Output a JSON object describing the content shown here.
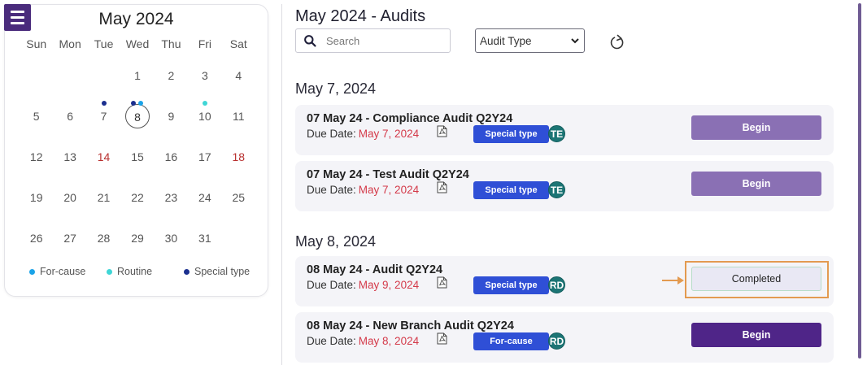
{
  "calendar": {
    "title": "May 2024",
    "weekdays": [
      "Sun",
      "Mon",
      "Tue",
      "Wed",
      "Thu",
      "Fri",
      "Sat"
    ],
    "leading_blanks": 3,
    "days": [
      1,
      2,
      3,
      4,
      5,
      6,
      7,
      8,
      9,
      10,
      11,
      12,
      13,
      14,
      15,
      16,
      17,
      18,
      19,
      20,
      21,
      22,
      23,
      24,
      25,
      26,
      27,
      28,
      29,
      30,
      31
    ],
    "today": 8,
    "red_days": [
      14,
      18
    ],
    "event_dots": {
      "7": [
        "special"
      ],
      "8": [
        "special",
        "for-cause"
      ],
      "10": [
        "routine"
      ]
    },
    "legend": [
      {
        "key": "for-cause",
        "label": "For-cause",
        "color": "#1aa3e8"
      },
      {
        "key": "routine",
        "label": "Routine",
        "color": "#3fd6d6"
      },
      {
        "key": "special",
        "label": "Special type",
        "color": "#1b2f8f"
      }
    ]
  },
  "main": {
    "title": "May 2024 - Audits",
    "search_placeholder": "Search",
    "audit_type_select": "Audit Type"
  },
  "groups": [
    {
      "date": "May 7, 2024",
      "audits": [
        {
          "title": "07 May 24 - Compliance Audit Q2Y24",
          "due_label": "Due Date:",
          "due_value": "May 7, 2024",
          "badge": "Special type",
          "avatar": "TE",
          "action": "Begin",
          "style": "light"
        },
        {
          "title": "07 May 24 - Test Audit Q2Y24",
          "due_label": "Due Date:",
          "due_value": "May 7, 2024",
          "badge": "Special type",
          "avatar": "TE",
          "action": "Begin",
          "style": "light"
        }
      ]
    },
    {
      "date": "May 8, 2024",
      "audits": [
        {
          "title": "08 May 24 - Audit Q2Y24",
          "due_label": "Due Date:",
          "due_value": "May 9, 2024",
          "badge": "Special type",
          "avatar": "RD",
          "action": "Completed",
          "style": "completed"
        },
        {
          "title": "08 May 24 - New Branch Audit Q2Y24",
          "due_label": "Due Date:",
          "due_value": "May 8, 2024",
          "badge": "For-cause",
          "avatar": "RD",
          "action": "Begin",
          "style": "dark"
        }
      ]
    }
  ],
  "colors": {
    "menu": "#4a2b7c",
    "begin_light": "#8a70b4",
    "begin_dark": "#4f2588",
    "badge": "#2f4fd6",
    "avatar": "#1c7575",
    "due_value": "#d43a4a",
    "highlight": "#e39a50"
  }
}
